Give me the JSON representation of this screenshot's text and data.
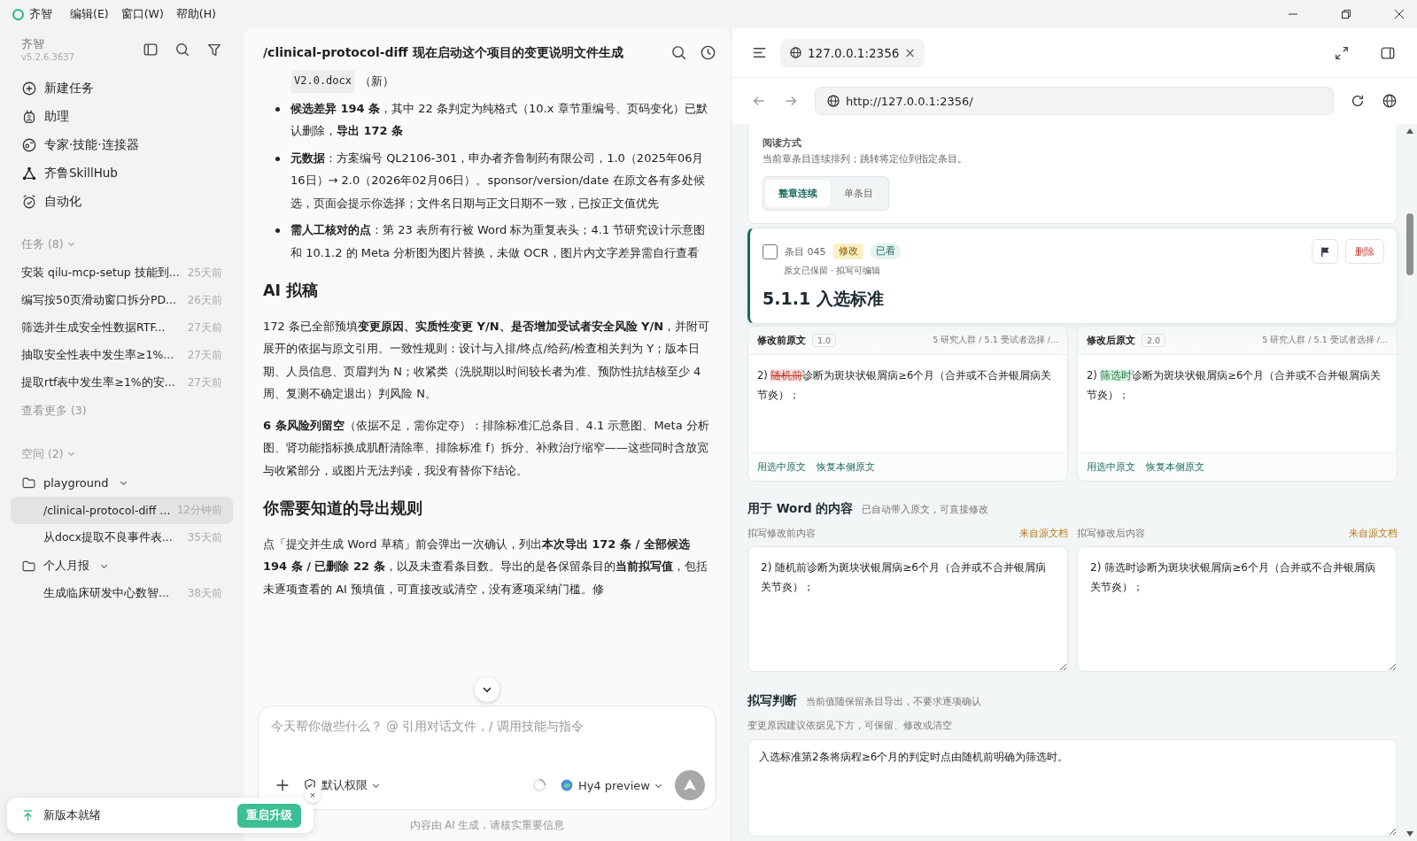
{
  "menu_bar": {
    "app_name": "齐智",
    "menus": [
      "编辑(E)",
      "窗口(W)",
      "帮助(H)"
    ]
  },
  "sidebar": {
    "app_name": "齐智",
    "version": "v5.2.6.3637",
    "nav": [
      {
        "label": "新建任务",
        "kind": "new"
      },
      {
        "label": "助理",
        "kind": "assistant"
      },
      {
        "label": "专家·技能·连接器",
        "kind": "expert"
      },
      {
        "label": "齐鲁SkillHub",
        "kind": "hub"
      },
      {
        "label": "自动化",
        "kind": "automation"
      }
    ],
    "tasks_header": "任务 (8)",
    "tasks": [
      {
        "title": "安装 qilu-mcp-setup 技能到...",
        "time": "25天前"
      },
      {
        "title": "编写按50页滑动窗口拆分PD...",
        "time": "26天前"
      },
      {
        "title": "筛选并生成安全性数据RTF...",
        "time": "27天前"
      },
      {
        "title": "抽取安全性表中发生率≥1%...",
        "time": "27天前"
      },
      {
        "title": "提取rtf表中发生率≥1%的安...",
        "time": "27天前"
      }
    ],
    "more": "查看更多 (3)",
    "spaces_header": "空间 (2)",
    "spaces": [
      {
        "name": "playground",
        "expanded": true,
        "children": [
          {
            "title": "/clinical-protocol-diff ...",
            "time": "12分钟前",
            "selected": true
          },
          {
            "title": "从docx提取不良事件表...",
            "time": "35天前",
            "selected": false
          }
        ]
      },
      {
        "name": "个人月报",
        "expanded": true,
        "children": [
          {
            "title": "生成临床研发中心数智...",
            "time": "38天前",
            "selected": false
          }
        ]
      }
    ]
  },
  "update_toast": {
    "text": "新版本就绪",
    "button": "重启升级",
    "close": "×"
  },
  "chat": {
    "title": "/clinical-protocol-diff 现在启动这个项目的变更说明文件生成",
    "blocks": [
      {
        "kind": "code_line",
        "code": "V2.0.docx",
        "text": "（新）"
      },
      {
        "kind": "bullet",
        "text": "**候选差异 194 条**，其中 22 条判定为纯格式（10.x 章节重编号、页码变化）已默认删除，**导出 172 条**"
      },
      {
        "kind": "bullet",
        "text": "**元数据**：方案编号 QL2106-301，申办者齐鲁制药有限公司，1.0（2025年06月16日）→ 2.0（2026年02月06日）。sponsor/version/date 在原文各有多处候选，页面会提示你选择；文件名日期与正文日期不一致，已按正文值优先"
      },
      {
        "kind": "bullet",
        "text": "**需人工核对的点**：第 23 表所有行被 Word 标为重复表头；4.1 节研究设计示意图和 10.1.2 的 Meta 分析图为图片替换，未做 OCR，图片内文字差异需自行查看"
      },
      {
        "kind": "heading",
        "text": "AI 拟稿"
      },
      {
        "kind": "paragraph",
        "text": "172 条已全部预填**变更原因、实质性变更 Y/N、是否增加受试者安全风险 Y/N**，并附可展开的依据与原文引用。一致性规则：设计与入排/终点/给药/检查相关判为 Y；版本日期、人员信息、页眉判为 N；收紧类（洗脱期以时间较长者为准、预防性抗结核至少 4 周、复测不确定退出）判风险 N。"
      },
      {
        "kind": "paragraph",
        "text": "**6 条风险列留空**（依据不足，需你定夺）：排除标准汇总条目、4.1 示意图、Meta 分析图、肾功能指标换成肌酐清除率、排除标准 f）拆分、补救治疗缩窄——这些同时含放宽与收紧部分，或图片无法判读，我没有替你下结论。"
      },
      {
        "kind": "heading",
        "text": "你需要知道的导出规则"
      },
      {
        "kind": "paragraph",
        "text": "点「提交并生成 Word 草稿」前会弹出一次确认，列出**本次导出 172 条 / 全部候选 194 条 / 已删除 22 条**，以及未查看条目数。导出的是各保留条目的**当前拟写值**，包括未逐项查看的 AI 预填值，可直接改或清空，没有逐项采纳门槛。修"
      }
    ],
    "input": {
      "placeholder": "今天帮你做些什么？ @ 引用对话文件，/ 调用技能与指令",
      "permission": "默认权限",
      "model": "Hy4 preview"
    },
    "footer": "内容由 AI 生成，请核实重要信息"
  },
  "browser": {
    "tab": {
      "title": "127.0.0.1:2356",
      "close": "×"
    },
    "url": "http://127.0.0.1:2356/",
    "reading": {
      "title": "阅读方式",
      "description": "当前章条目连续排列；跳转将定位到指定条目。",
      "modes": [
        {
          "label": "整章连续",
          "selected": true
        },
        {
          "label": "单条目",
          "selected": false
        }
      ]
    },
    "item": {
      "checked": false,
      "number": "条目 045",
      "tags": [
        {
          "label": "修改",
          "kind": "change"
        },
        {
          "label": "已看",
          "kind": "seen"
        }
      ],
      "note": "原文已保留 · 拟写可编辑",
      "heading": "5.1.1 入选标准",
      "delete": "删除"
    },
    "panes": [
      {
        "title": "修改前原文",
        "version": "1.0",
        "path": "5 研究人群 / 5.1 受试者选择 /...",
        "segments": [
          {
            "text": "2) ",
            "kind": "plain"
          },
          {
            "text": "随机前",
            "kind": "deleted"
          },
          {
            "text": "诊断为斑块状银屑病≥6个月（合并或不合并银屑病关节炎）；",
            "kind": "plain"
          }
        ],
        "actions": [
          "用选中原文",
          "恢复本侧原文"
        ]
      },
      {
        "title": "修改后原文",
        "version": "2.0",
        "path": "5 研究人群 / 5.1 受试者选择 /...",
        "segments": [
          {
            "text": "2) ",
            "kind": "plain"
          },
          {
            "text": "筛选时",
            "kind": "inserted"
          },
          {
            "text": "诊断为斑块状银屑病≥6个月（合并或不合并银屑病关节炎）；",
            "kind": "plain"
          }
        ],
        "actions": [
          "用选中原文",
          "恢复本侧原文"
        ]
      }
    ],
    "word": {
      "title": "用于 Word 的内容",
      "hint": "已自动带入原文，可直接修改",
      "fields": [
        {
          "label": "拟写修改前内容",
          "source": "来自源文档",
          "value": "2) 随机前诊断为斑块状银屑病≥6个月（合并或不合并银屑病关节炎）；"
        },
        {
          "label": "拟写修改后内容",
          "source": "来自源文档",
          "value": "2) 筛选时诊断为斑块状银屑病≥6个月（合并或不合并银屑病关节炎）；"
        }
      ]
    },
    "judgement": {
      "title": "拟写判断",
      "hint": "当前值随保留条目导出，不要求逐项确认",
      "label": "变更原因建议依据见下方，可保留、修改或清空",
      "value": "入选标准第2条将病程≥6个月的判定时点由随机前明确为筛选时。"
    }
  }
}
